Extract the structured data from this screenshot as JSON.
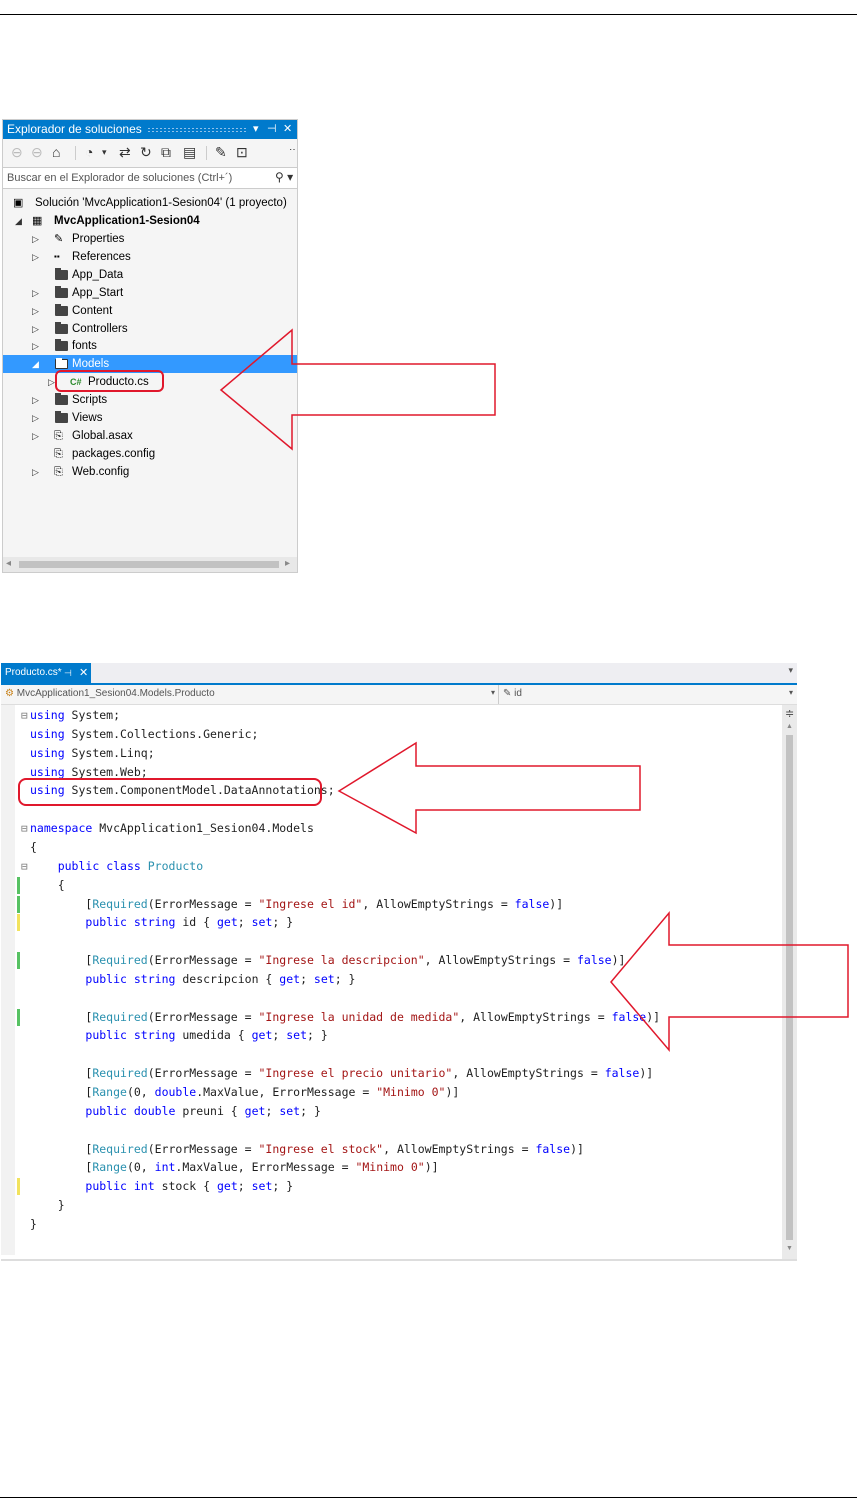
{
  "solution_explorer": {
    "title": "Explorador de soluciones",
    "title_controls": [
      "▾",
      "⊣",
      "✕"
    ],
    "toolbar_icons": [
      "back-icon",
      "forward-icon",
      "home-icon",
      "history-icon",
      "sync-icon",
      "refresh-icon",
      "collapse-all-icon",
      "show-all-files-icon",
      "properties-icon",
      "preview-icon"
    ],
    "search_placeholder": "Buscar en el Explorador de soluciones (Ctrl+´)",
    "solution": "Solución 'MvcApplication1-Sesion04'  (1 proyecto)",
    "project": "MvcApplication1-Sesion04",
    "items": [
      {
        "label": "Properties",
        "icon": "wrench-icon",
        "expander": "▷"
      },
      {
        "label": "References",
        "icon": "references-icon",
        "expander": "▷"
      },
      {
        "label": "App_Data",
        "icon": "folder-icon",
        "expander": ""
      },
      {
        "label": "App_Start",
        "icon": "folder-icon",
        "expander": "▷"
      },
      {
        "label": "Content",
        "icon": "folder-icon",
        "expander": "▷"
      },
      {
        "label": "Controllers",
        "icon": "folder-icon",
        "expander": "▷"
      },
      {
        "label": "fonts",
        "icon": "folder-icon",
        "expander": "▷"
      },
      {
        "label": "Models",
        "icon": "folder-icon",
        "expander": "◢",
        "selected": true
      },
      {
        "label": "Producto.cs",
        "icon": "csharp-file-icon",
        "expander": "▷",
        "child": true
      },
      {
        "label": "Scripts",
        "icon": "folder-icon",
        "expander": "▷"
      },
      {
        "label": "Views",
        "icon": "folder-icon",
        "expander": "▷"
      },
      {
        "label": "Global.asax",
        "icon": "config-file-icon",
        "expander": "▷"
      },
      {
        "label": "packages.config",
        "icon": "config-file-icon",
        "expander": ""
      },
      {
        "label": "Web.config",
        "icon": "config-file-icon",
        "expander": "▷"
      }
    ],
    "csharp_badge": "C#"
  },
  "editor": {
    "tab_label": "Producto.cs*",
    "tab_pin": "⊣",
    "tab_close": "✕",
    "nav_left": "MvcApplication1_Sesion04.Models.Producto",
    "nav_right": "id",
    "code_lines": [
      [
        [
          "k",
          "using"
        ],
        [
          "t",
          " System;"
        ]
      ],
      [
        [
          "k",
          "using"
        ],
        [
          "t",
          " System.Collections.Generic;"
        ]
      ],
      [
        [
          "k",
          "using"
        ],
        [
          "t",
          " System.Linq;"
        ]
      ],
      [
        [
          "k",
          "using"
        ],
        [
          "t",
          " System.Web;"
        ]
      ],
      [
        [
          "k",
          "using"
        ],
        [
          "t",
          " System.ComponentModel.DataAnnotations;"
        ]
      ],
      [],
      [
        [
          "k",
          "namespace"
        ],
        [
          "t",
          " MvcApplication1_Sesion04.Models"
        ]
      ],
      [
        [
          "t",
          "{"
        ]
      ],
      [
        [
          "t",
          "    "
        ],
        [
          "k",
          "public"
        ],
        [
          "t",
          " "
        ],
        [
          "k",
          "class"
        ],
        [
          "t",
          " "
        ],
        [
          "ty",
          "Producto"
        ]
      ],
      [
        [
          "t",
          "    {"
        ]
      ],
      [
        [
          "t",
          "        ["
        ],
        [
          "ty",
          "Required"
        ],
        [
          "t",
          "(ErrorMessage = "
        ],
        [
          "s",
          "\"Ingrese el id\""
        ],
        [
          "t",
          ", AllowEmptyStrings = "
        ],
        [
          "k",
          "false"
        ],
        [
          "t",
          ")]"
        ]
      ],
      [
        [
          "t",
          "        "
        ],
        [
          "k",
          "public"
        ],
        [
          "t",
          " "
        ],
        [
          "k",
          "string"
        ],
        [
          "t",
          " id { "
        ],
        [
          "k",
          "get"
        ],
        [
          "t",
          "; "
        ],
        [
          "k",
          "set"
        ],
        [
          "t",
          "; }"
        ]
      ],
      [],
      [
        [
          "t",
          "        ["
        ],
        [
          "ty",
          "Required"
        ],
        [
          "t",
          "(ErrorMessage = "
        ],
        [
          "s",
          "\"Ingrese la descripcion\""
        ],
        [
          "t",
          ", AllowEmptyStrings = "
        ],
        [
          "k",
          "false"
        ],
        [
          "t",
          ")]"
        ]
      ],
      [
        [
          "t",
          "        "
        ],
        [
          "k",
          "public"
        ],
        [
          "t",
          " "
        ],
        [
          "k",
          "string"
        ],
        [
          "t",
          " descripcion { "
        ],
        [
          "k",
          "get"
        ],
        [
          "t",
          "; "
        ],
        [
          "k",
          "set"
        ],
        [
          "t",
          "; }"
        ]
      ],
      [],
      [
        [
          "t",
          "        ["
        ],
        [
          "ty",
          "Required"
        ],
        [
          "t",
          "(ErrorMessage = "
        ],
        [
          "s",
          "\"Ingrese la unidad de medida\""
        ],
        [
          "t",
          ", AllowEmptyStrings = "
        ],
        [
          "k",
          "false"
        ],
        [
          "t",
          ")]"
        ]
      ],
      [
        [
          "t",
          "        "
        ],
        [
          "k",
          "public"
        ],
        [
          "t",
          " "
        ],
        [
          "k",
          "string"
        ],
        [
          "t",
          " umedida { "
        ],
        [
          "k",
          "get"
        ],
        [
          "t",
          "; "
        ],
        [
          "k",
          "set"
        ],
        [
          "t",
          "; }"
        ]
      ],
      [],
      [
        [
          "t",
          "        ["
        ],
        [
          "ty",
          "Required"
        ],
        [
          "t",
          "(ErrorMessage = "
        ],
        [
          "s",
          "\"Ingrese el precio unitario\""
        ],
        [
          "t",
          ", AllowEmptyStrings = "
        ],
        [
          "k",
          "false"
        ],
        [
          "t",
          ")]"
        ]
      ],
      [
        [
          "t",
          "        ["
        ],
        [
          "ty",
          "Range"
        ],
        [
          "t",
          "(0, "
        ],
        [
          "k",
          "double"
        ],
        [
          "t",
          ".MaxValue, ErrorMessage = "
        ],
        [
          "s",
          "\"Minimo 0\""
        ],
        [
          "t",
          ")]"
        ]
      ],
      [
        [
          "t",
          "        "
        ],
        [
          "k",
          "public"
        ],
        [
          "t",
          " "
        ],
        [
          "k",
          "double"
        ],
        [
          "t",
          " preuni { "
        ],
        [
          "k",
          "get"
        ],
        [
          "t",
          "; "
        ],
        [
          "k",
          "set"
        ],
        [
          "t",
          "; }"
        ]
      ],
      [],
      [
        [
          "t",
          "        ["
        ],
        [
          "ty",
          "Required"
        ],
        [
          "t",
          "(ErrorMessage = "
        ],
        [
          "s",
          "\"Ingrese el stock\""
        ],
        [
          "t",
          ", AllowEmptyStrings = "
        ],
        [
          "k",
          "false"
        ],
        [
          "t",
          ")]"
        ]
      ],
      [
        [
          "t",
          "        ["
        ],
        [
          "ty",
          "Range"
        ],
        [
          "t",
          "(0, "
        ],
        [
          "k",
          "int"
        ],
        [
          "t",
          ".MaxValue, ErrorMessage = "
        ],
        [
          "s",
          "\"Minimo 0\""
        ],
        [
          "t",
          ")]"
        ]
      ],
      [
        [
          "t",
          "        "
        ],
        [
          "k",
          "public"
        ],
        [
          "t",
          " "
        ],
        [
          "k",
          "int"
        ],
        [
          "t",
          " stock { "
        ],
        [
          "k",
          "get"
        ],
        [
          "t",
          "; "
        ],
        [
          "k",
          "set"
        ],
        [
          "t",
          "; }"
        ]
      ],
      [
        [
          "t",
          "    }"
        ]
      ],
      [
        [
          "t",
          "}"
        ]
      ]
    ],
    "change_bars": [
      {
        "line": 9,
        "color": "green"
      },
      {
        "line": 10,
        "color": "green"
      },
      {
        "line": 11,
        "color": "yellow"
      },
      {
        "line": 13,
        "color": "green"
      },
      {
        "line": 16,
        "color": "green"
      },
      {
        "line": 25,
        "color": "yellow"
      }
    ]
  },
  "colors": {
    "vs_blue": "#007acc",
    "selection": "#3399ff",
    "keyword": "#0000ff",
    "type": "#2b91af",
    "string": "#a31515",
    "annotation": "#e0182c"
  }
}
